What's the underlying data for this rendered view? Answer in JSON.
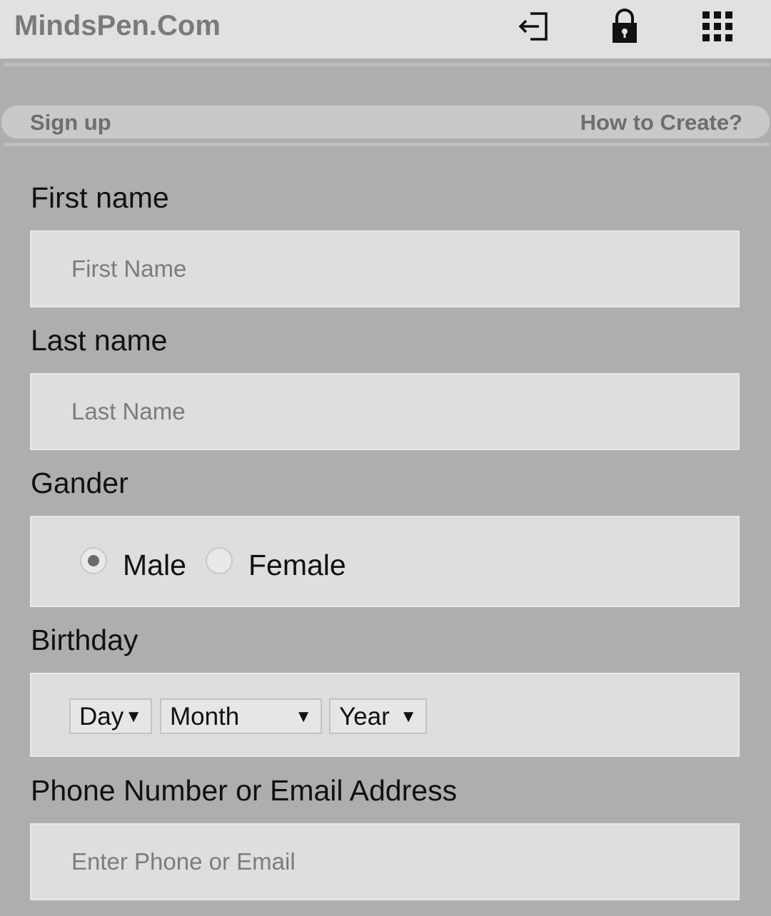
{
  "header": {
    "brand": "MindsPen.Com",
    "icons": [
      "login-icon",
      "lock-icon",
      "apps-grid-icon"
    ]
  },
  "subbar": {
    "left": "Sign up",
    "right": "How to Create?"
  },
  "form": {
    "first_name": {
      "label": "First name",
      "placeholder": "First Name"
    },
    "last_name": {
      "label": "Last name",
      "placeholder": "Last Name"
    },
    "gender": {
      "label": "Gander",
      "options": [
        "Male",
        "Female"
      ],
      "selected": "Male"
    },
    "birthday": {
      "label": "Birthday",
      "day": "Day",
      "month": "Month",
      "year": "Year"
    },
    "contact": {
      "label": "Phone Number or Email Address",
      "placeholder": "Enter Phone or Email"
    }
  },
  "colors": {
    "background": "#aeaeae",
    "header": "#e1e1e1",
    "field": "#dedede"
  }
}
